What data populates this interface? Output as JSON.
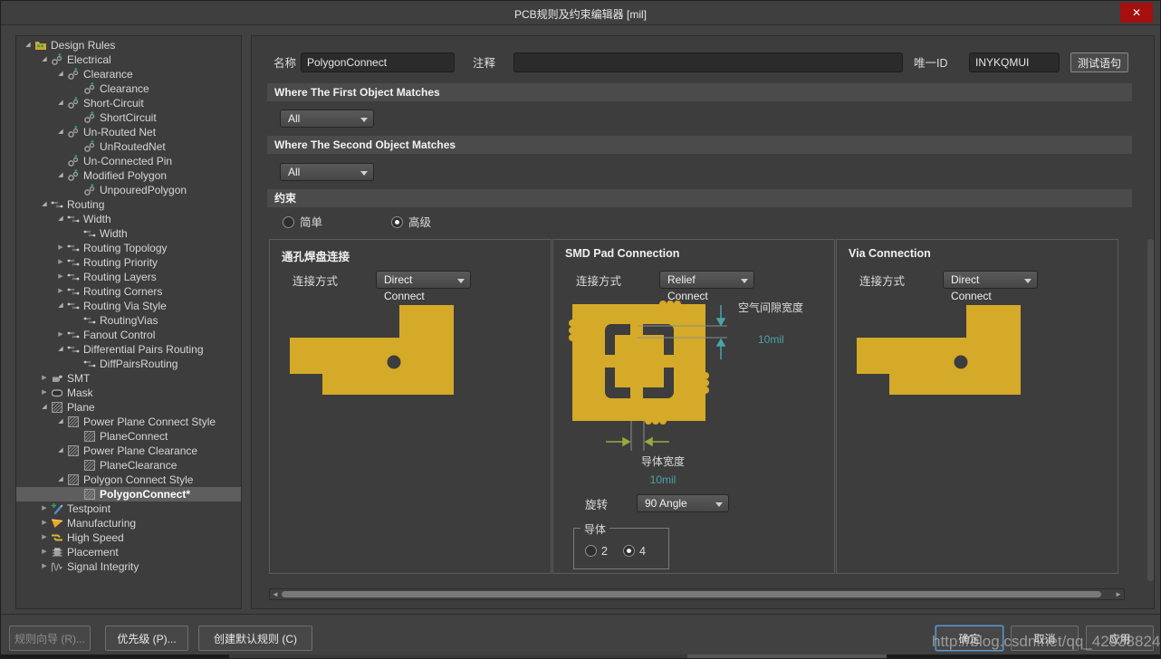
{
  "window": {
    "title": "PCB规则及约束编辑器 [mil]",
    "close_glyph": "✕"
  },
  "colors": {
    "copper": "#d4aa28",
    "teal": "#4aa3ab",
    "green_arrow": "#9ba93f",
    "panel_bg": "#3d3d3d",
    "focus_blue": "#5b9bd5",
    "close_red": "#a50f0f"
  },
  "tree": {
    "items": [
      {
        "label": "Design Rules",
        "level": 0,
        "icon": "folder",
        "state": "open",
        "selected": false
      },
      {
        "label": "Electrical",
        "level": 1,
        "icon": "electrical",
        "state": "open",
        "selected": false
      },
      {
        "label": "Clearance",
        "level": 2,
        "icon": "electrical",
        "state": "open",
        "selected": false
      },
      {
        "label": "Clearance",
        "level": 3,
        "icon": "electrical",
        "state": "none",
        "selected": false
      },
      {
        "label": "Short-Circuit",
        "level": 2,
        "icon": "electrical",
        "state": "open",
        "selected": false
      },
      {
        "label": "ShortCircuit",
        "level": 3,
        "icon": "electrical",
        "state": "none",
        "selected": false
      },
      {
        "label": "Un-Routed Net",
        "level": 2,
        "icon": "electrical",
        "state": "open",
        "selected": false
      },
      {
        "label": "UnRoutedNet",
        "level": 3,
        "icon": "electrical",
        "state": "none",
        "selected": false
      },
      {
        "label": "Un-Connected Pin",
        "level": 2,
        "icon": "electrical",
        "state": "none",
        "selected": false
      },
      {
        "label": "Modified Polygon",
        "level": 2,
        "icon": "electrical",
        "state": "open",
        "selected": false
      },
      {
        "label": "UnpouredPolygon",
        "level": 3,
        "icon": "electrical",
        "state": "none",
        "selected": false
      },
      {
        "label": "Routing",
        "level": 1,
        "icon": "routing",
        "state": "open",
        "selected": false
      },
      {
        "label": "Width",
        "level": 2,
        "icon": "routing",
        "state": "open",
        "selected": false
      },
      {
        "label": "Width",
        "level": 3,
        "icon": "routing",
        "state": "none",
        "selected": false
      },
      {
        "label": "Routing Topology",
        "level": 2,
        "icon": "routing",
        "state": "closed",
        "selected": false
      },
      {
        "label": "Routing Priority",
        "level": 2,
        "icon": "routing",
        "state": "closed",
        "selected": false
      },
      {
        "label": "Routing Layers",
        "level": 2,
        "icon": "routing",
        "state": "closed",
        "selected": false
      },
      {
        "label": "Routing Corners",
        "level": 2,
        "icon": "routing",
        "state": "closed",
        "selected": false
      },
      {
        "label": "Routing Via Style",
        "level": 2,
        "icon": "routing",
        "state": "open",
        "selected": false
      },
      {
        "label": "RoutingVias",
        "level": 3,
        "icon": "routing",
        "state": "none",
        "selected": false
      },
      {
        "label": "Fanout Control",
        "level": 2,
        "icon": "routing",
        "state": "closed",
        "selected": false
      },
      {
        "label": "Differential Pairs Routing",
        "level": 2,
        "icon": "routing",
        "state": "open",
        "selected": false
      },
      {
        "label": "DiffPairsRouting",
        "level": 3,
        "icon": "routing",
        "state": "none",
        "selected": false
      },
      {
        "label": "SMT",
        "level": 1,
        "icon": "smt",
        "state": "closed",
        "selected": false
      },
      {
        "label": "Mask",
        "level": 1,
        "icon": "mask",
        "state": "closed",
        "selected": false
      },
      {
        "label": "Plane",
        "level": 1,
        "icon": "plane",
        "state": "open",
        "selected": false
      },
      {
        "label": "Power Plane Connect Style",
        "level": 2,
        "icon": "plane",
        "state": "open",
        "selected": false
      },
      {
        "label": "PlaneConnect",
        "level": 3,
        "icon": "plane",
        "state": "none",
        "selected": false
      },
      {
        "label": "Power Plane Clearance",
        "level": 2,
        "icon": "plane",
        "state": "open",
        "selected": false
      },
      {
        "label": "PlaneClearance",
        "level": 3,
        "icon": "plane",
        "state": "none",
        "selected": false
      },
      {
        "label": "Polygon Connect Style",
        "level": 2,
        "icon": "plane",
        "state": "open",
        "selected": false
      },
      {
        "label": "PolygonConnect*",
        "level": 3,
        "icon": "plane",
        "state": "none",
        "selected": true
      },
      {
        "label": "Testpoint",
        "level": 1,
        "icon": "testpoint",
        "state": "closed",
        "selected": false
      },
      {
        "label": "Manufacturing",
        "level": 1,
        "icon": "manufacturing",
        "state": "closed",
        "selected": false
      },
      {
        "label": "High Speed",
        "level": 1,
        "icon": "highspeed",
        "state": "closed",
        "selected": false
      },
      {
        "label": "Placement",
        "level": 1,
        "icon": "placement",
        "state": "closed",
        "selected": false
      },
      {
        "label": "Signal Integrity",
        "level": 1,
        "icon": "signal",
        "state": "closed",
        "selected": false
      }
    ]
  },
  "form": {
    "name_label": "名称",
    "name_value": "PolygonConnect",
    "comment_label": "注释",
    "comment_value": "",
    "unique_id_label": "唯一ID",
    "unique_id_value": "INYKQMUI",
    "test_button": "测试语句"
  },
  "matches": {
    "first_header": "Where The First Object Matches",
    "first_value": "All",
    "second_header": "Where The Second Object Matches",
    "second_value": "All"
  },
  "constraints": {
    "header": "约束",
    "simple_label": "简单",
    "advanced_label": "高级",
    "selected": "高级"
  },
  "panels": {
    "through_hole": {
      "title": "通孔焊盘连接",
      "connect_label": "连接方式",
      "connect_value": "Direct Connect"
    },
    "smd": {
      "title": "SMD Pad Connection",
      "connect_label": "连接方式",
      "connect_value": "Relief Connect",
      "air_gap_label": "空气间隙宽度",
      "air_gap_value": "10mil",
      "conductor_width_label": "导体宽度",
      "conductor_width_value": "10mil",
      "rotation_label": "旋转",
      "rotation_value": "90 Angle",
      "conductors_group_label": "导体",
      "conductors_option_2": "2",
      "conductors_option_4": "4",
      "conductors_selected": "4"
    },
    "via": {
      "title": "Via Connection",
      "connect_label": "连接方式",
      "connect_value": "Direct Connect"
    }
  },
  "footer": {
    "wizard_button": "规则向导 (R)...",
    "priority_button": "优先级 (P)...",
    "create_default_button": "创建默认规则 (C)",
    "ok_button": "确定",
    "cancel_button": "取消",
    "apply_button": "应用"
  },
  "watermark_text": "http://blog.csdn.net/qq_42938824"
}
